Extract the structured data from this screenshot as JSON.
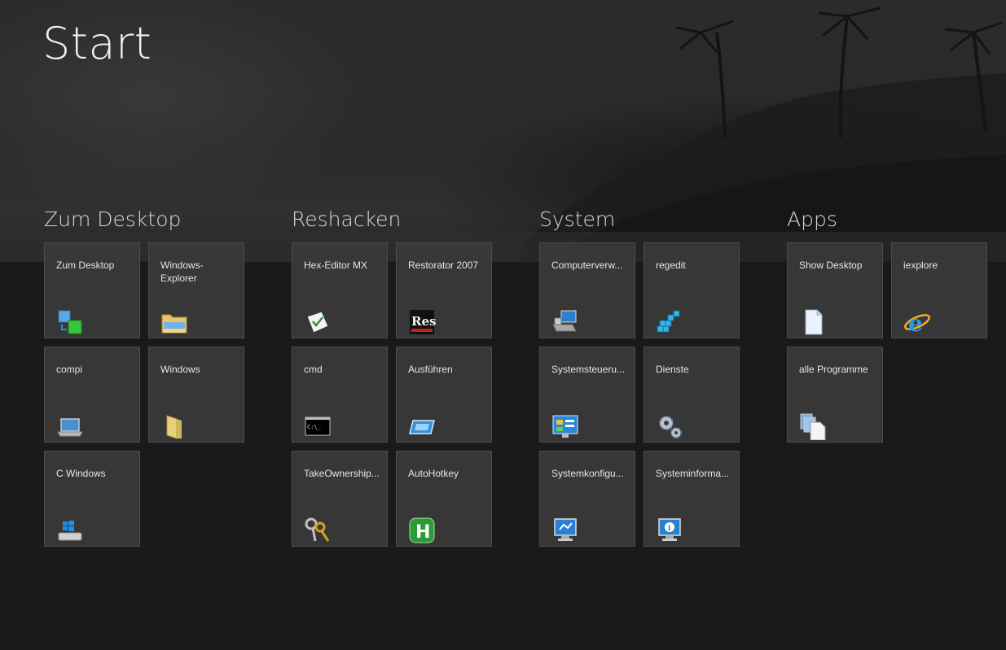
{
  "start_screen": {
    "title": "Start"
  },
  "groups": [
    {
      "title": "Zum Desktop",
      "tiles": [
        {
          "label": "Zum Desktop",
          "icon": "desktop-switch-icon"
        },
        {
          "label": "Windows-Explorer",
          "icon": "explorer-folder-icon"
        },
        {
          "label": "compi",
          "icon": "laptop-icon"
        },
        {
          "label": "Windows",
          "icon": "folder-icon"
        },
        {
          "label": "C Windows",
          "icon": "drive-windows-icon"
        }
      ]
    },
    {
      "title": "Reshacken",
      "tiles": [
        {
          "label": "Hex-Editor MX",
          "icon": "hex-editor-icon"
        },
        {
          "label": "Restorator 2007",
          "icon": "res-icon"
        },
        {
          "label": "cmd",
          "icon": "terminal-icon"
        },
        {
          "label": "Ausführen",
          "icon": "run-icon"
        },
        {
          "label": "TakeOwnership...",
          "icon": "keys-icon"
        },
        {
          "label": "AutoHotkey",
          "icon": "autohotkey-icon"
        }
      ]
    },
    {
      "title": "System",
      "tiles": [
        {
          "label": "Computerverw...",
          "icon": "computer-management-icon"
        },
        {
          "label": "regedit",
          "icon": "registry-icon"
        },
        {
          "label": "Systemsteueru...",
          "icon": "control-panel-icon"
        },
        {
          "label": "Dienste",
          "icon": "gears-icon"
        },
        {
          "label": "Systemkonfigu...",
          "icon": "system-config-icon"
        },
        {
          "label": "Systeminforma...",
          "icon": "system-info-icon"
        }
      ]
    },
    {
      "title": "Apps",
      "tiles": [
        {
          "label": "Show Desktop",
          "icon": "document-icon"
        },
        {
          "label": "iexplore",
          "icon": "internet-explorer-icon"
        },
        {
          "label": "alle Programme",
          "icon": "programs-icon"
        }
      ]
    }
  ],
  "colors": {
    "background": "#1a1a1a",
    "tile": "#3a3a3a",
    "tile_border": "#4c4c4c",
    "text": "#e6e6e6"
  }
}
